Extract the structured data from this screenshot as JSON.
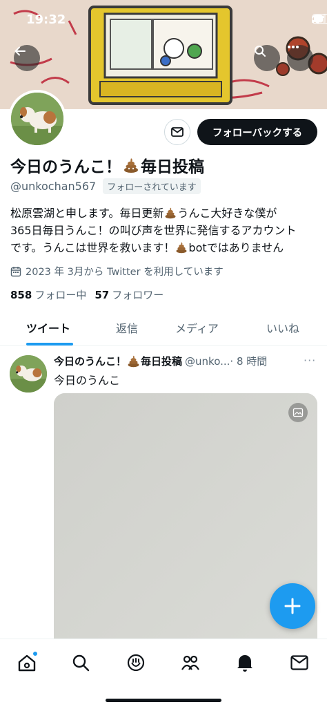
{
  "status_bar": {
    "time": "19:32"
  },
  "profile": {
    "display_name": "今日のうんこ！",
    "display_name_suffix": "毎日投稿",
    "handle": "@unkochan567",
    "follows_you": "フォローされています",
    "follow_back_label": "フォローバックする",
    "bio": {
      "line1a": "松原雲湖と申します。毎日更新",
      "line1b": "うんこ大好きな僕が",
      "line2": "365日毎日うんこ！の叫び声を世界に発信するアカウント",
      "line3a": "です。うんこは世界を救います！",
      "line3b": "botではありません"
    },
    "joined": "2023 年 3月から Twitter を利用しています",
    "following_count": "858",
    "following_label": "フォロー中",
    "followers_count": "57",
    "followers_label": "フォロワー"
  },
  "tabs": [
    {
      "label": "ツイート"
    },
    {
      "label": "返信"
    },
    {
      "label": "メディア"
    },
    {
      "label": "いいね"
    }
  ],
  "tweet": {
    "name": "今日のうんこ！",
    "name_suffix": "毎日投稿",
    "handle": "@unko...",
    "time": "· 8 時間",
    "more": "···",
    "text": "今日のうんこ"
  },
  "colors": {
    "accent": "#1d9bf0",
    "text": "#0f1419",
    "muted": "#536471"
  }
}
